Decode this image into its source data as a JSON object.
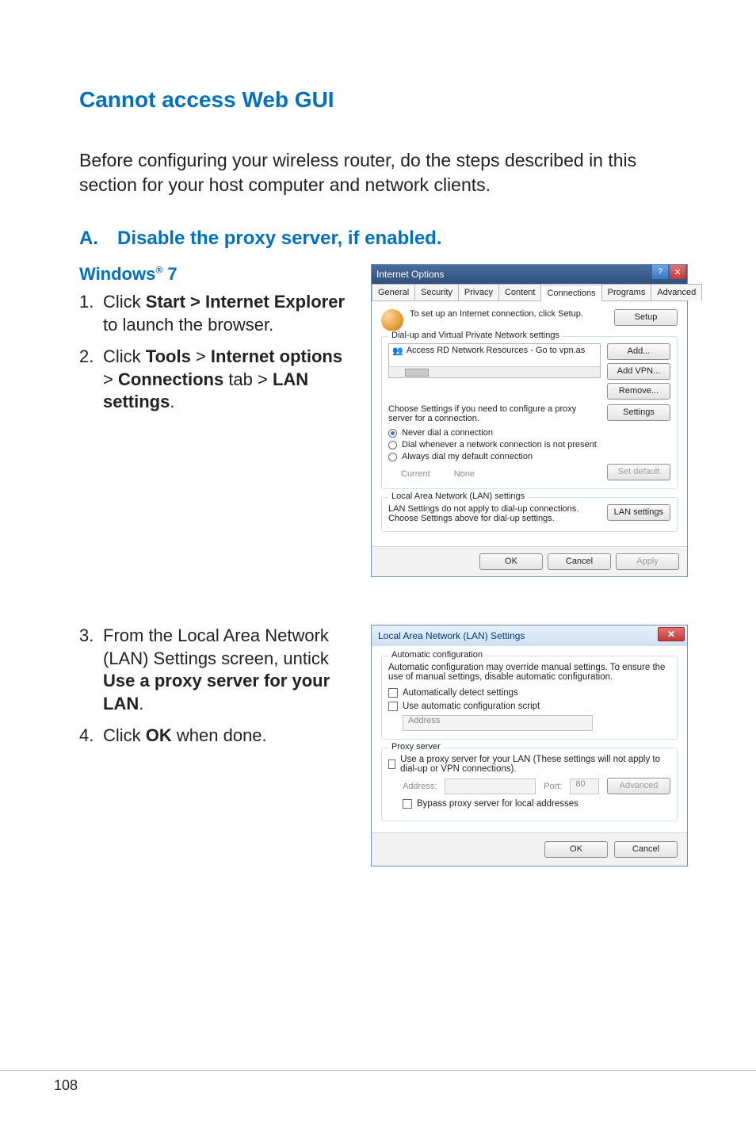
{
  "page": {
    "h1": "Cannot access Web GUI",
    "intro": "Before configuring your wireless router, do the steps described in this section for your host computer and network clients.",
    "sectionA_label": "A. Disable the proxy server, if enabled.",
    "win7_label": "Windows",
    "win7_reg": "®",
    "win7_suffix": " 7",
    "step1_pre": "Click ",
    "step1_bold": "Start > Internet Explorer",
    "step1_post": " to launch the browser.",
    "step2_pre": "Click ",
    "step2_b1": "Tools",
    "step2_m1": " > ",
    "step2_b2": "Internet options",
    "step2_m2": " > ",
    "step2_b3": "Connections",
    "step2_m3": " tab > ",
    "step2_b4": "LAN settings",
    "step2_end": ".",
    "step3_pre": "From the Local Area Network (LAN) Settings screen, untick ",
    "step3_bold": "Use a proxy server for your LAN",
    "step3_end": ".",
    "step4_pre": "Click ",
    "step4_bold": "OK",
    "step4_post": " when done.",
    "number": "108"
  },
  "io": {
    "title": "Internet Options",
    "tabs": [
      "General",
      "Security",
      "Privacy",
      "Content",
      "Connections",
      "Programs",
      "Advanced"
    ],
    "setup_text": "To set up an Internet connection, click Setup.",
    "setup_btn": "Setup",
    "group1": "Dial-up and Virtual Private Network settings",
    "vpn_item": "Access RD Network Resources - Go to vpn.as",
    "add_btn": "Add...",
    "addvpn_btn": "Add VPN...",
    "remove_btn": "Remove...",
    "choose_text": "Choose Settings if you need to configure a proxy server for a connection.",
    "settings_btn": "Settings",
    "r1": "Never dial a connection",
    "r2": "Dial whenever a network connection is not present",
    "r3": "Always dial my default connection",
    "current_lbl": "Current",
    "current_val": "None",
    "setdefault_btn": "Set default",
    "group2": "Local Area Network (LAN) settings",
    "lan_text": "LAN Settings do not apply to dial-up connections. Choose Settings above for dial-up settings.",
    "lan_btn": "LAN settings",
    "ok": "OK",
    "cancel": "Cancel",
    "apply": "Apply"
  },
  "lan": {
    "title": "Local Area Network (LAN) Settings",
    "grp1": "Automatic configuration",
    "desc": "Automatic configuration may override manual settings.  To ensure the use of manual settings, disable automatic configuration.",
    "c1": "Automatically detect settings",
    "c2": "Use automatic configuration script",
    "addr_ph": "Address",
    "grp2": "Proxy server",
    "c3": "Use a proxy server for your LAN (These settings will not apply to dial-up or VPN connections).",
    "addr_lbl": "Address:",
    "port_lbl": "Port:",
    "port_val": "80",
    "adv_btn": "Advanced",
    "c4": "Bypass proxy server for local addresses",
    "ok": "OK",
    "cancel": "Cancel"
  }
}
